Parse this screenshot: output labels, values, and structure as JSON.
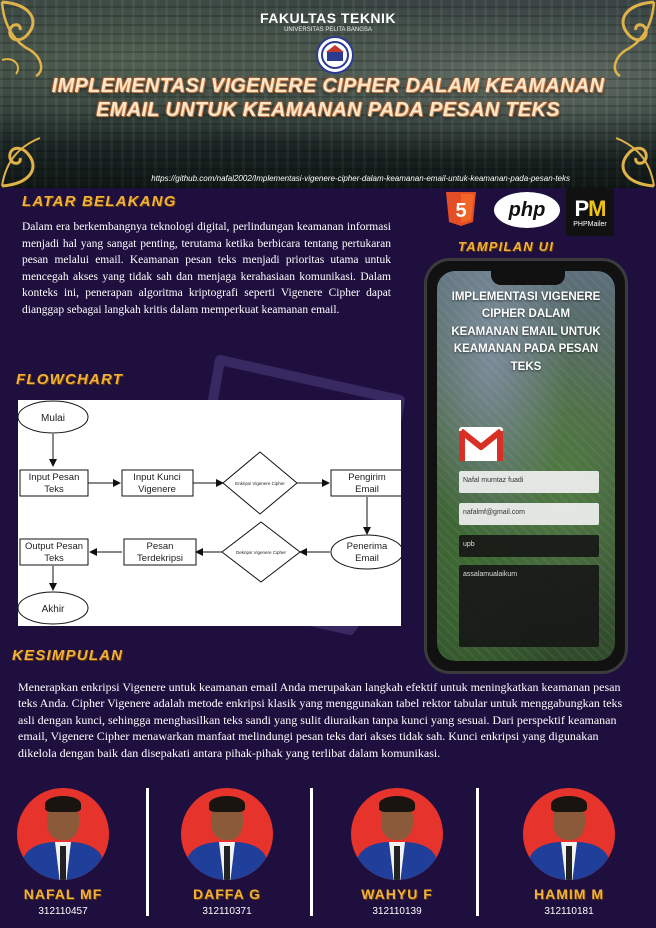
{
  "header": {
    "faculty": "FAKULTAS TEKNIK",
    "university": "UNIVERSITAS PELITA BANGSA",
    "title": "IMPLEMENTASI VIGENERE CIPHER DALAM KEAMANAN EMAIL UNTUK KEAMANAN PADA PESAN TEKS",
    "url": "https://github.com/nafal2002/Implementasi-vigenere-cipher-dalam-keamanan-email-untuk-keamanan-pada-pesan-teks"
  },
  "latar_belakang": {
    "heading": "LATAR BELAKANG",
    "text": "Dalam era berkembangnya teknologi digital, perlindungan keamanan informasi menjadi hal yang sangat penting, terutama ketika berbicara tentang pertukaran pesan melalui email. Keamanan pesan teks menjadi prioritas utama untuk mencegah akses yang tidak sah dan menjaga kerahasiaan komunikasi. Dalam konteks ini, penerapan algoritma kriptografi seperti Vigenere Cipher dapat dianggap sebagai langkah kritis dalam memperkuat keamanan email."
  },
  "tech": {
    "html5_label": "5",
    "php_label": "php",
    "phpmailer_label": "PHPMailer"
  },
  "tampilan_ui": {
    "heading": "TAMPILAN UI",
    "app_title": "IMPLEMENTASI VIGENERE CIPHER DALAM KEAMANAN EMAIL UNTUK KEAMANAN PADA PESAN TEKS",
    "fields": {
      "name": "Nafal mumtaz fuadi",
      "email": "nafalmf@gmail.com",
      "subject": "upb",
      "message": "assalamualaikum"
    }
  },
  "flowchart": {
    "heading": "FLOWCHART",
    "nodes": {
      "mulai": "Mulai",
      "input_pesan": "Input Pesan Teks",
      "input_kunci": "Input Kunci Vigenere",
      "enkripsi": "Enkripsi Vigenere Cipher",
      "pengirim": "Pengirim Email",
      "penerima": "Penerima Email",
      "dekripsi": "Dekripsi Vigenere Cipher",
      "pesan_terdekripsi": "Pesan Terdekripsi",
      "output_pesan": "Output Pesan Teks",
      "akhir": "Akhir"
    }
  },
  "kesimpulan": {
    "heading": "KESIMPULAN",
    "text": "Menerapkan enkripsi Vigenere untuk keamanan email Anda merupakan langkah efektif untuk meningkatkan keamanan pesan teks Anda. Cipher Vigenere adalah metode enkripsi klasik yang menggunakan tabel rektor tabular untuk menggabungkan teks asli dengan kunci, sehingga menghasilkan teks sandi yang sulit diuraikan tanpa kunci yang sesuai. Dari perspektif keamanan email, Vigenere Cipher menawarkan manfaat melindungi pesan teks dari akses tidak sah. Kunci enkripsi yang digunakan dikelola dengan baik dan disepakati antara pihak-pihak yang terlibat dalam komunikasi."
  },
  "team": [
    {
      "name": "NAFAL MF",
      "nim": "312110457"
    },
    {
      "name": "DAFFA G",
      "nim": "312110371"
    },
    {
      "name": "WAHYU F",
      "nim": "312110139"
    },
    {
      "name": "HAMIM M",
      "nim": "312110181"
    }
  ],
  "colors": {
    "background": "#1e0f3e",
    "heading": "#f2b13a",
    "avatar_bg": "#e6342c",
    "suit": "#1f3f9a"
  }
}
